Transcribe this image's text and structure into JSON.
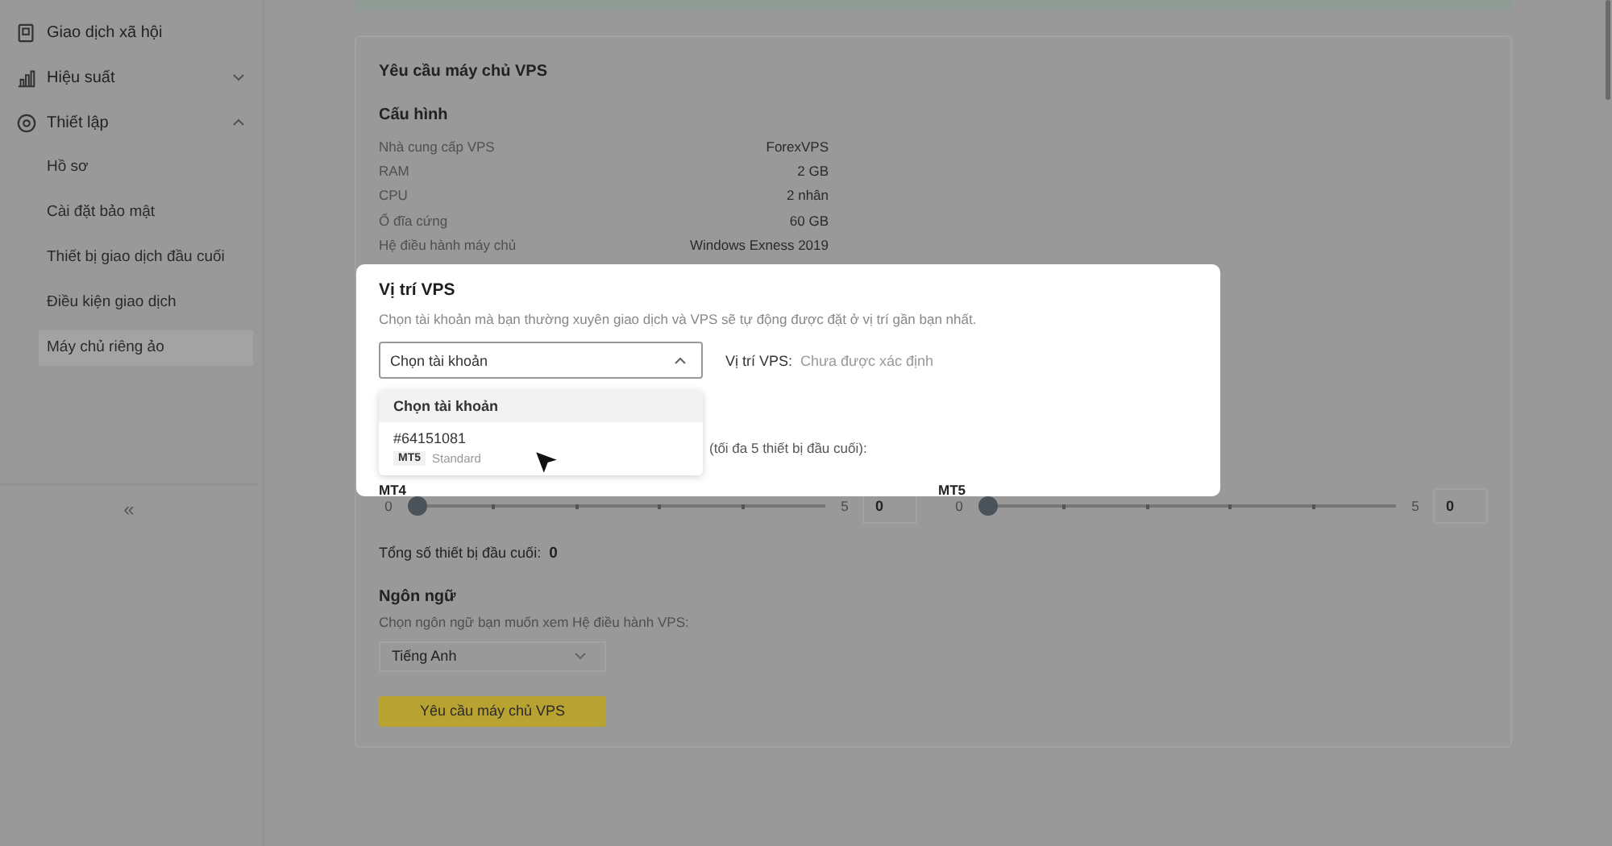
{
  "sidebar": {
    "items": [
      {
        "label": "Giao dịch xã hội"
      },
      {
        "label": "Hiệu suất",
        "expanded": false
      },
      {
        "label": "Thiết lập",
        "expanded": true,
        "children": [
          {
            "label": "Hồ sơ",
            "selected": false
          },
          {
            "label": "Cài đặt bảo mật",
            "selected": false
          },
          {
            "label": "Thiết bị giao dịch đầu cuối",
            "selected": false
          },
          {
            "label": "Điều kiện giao dịch",
            "selected": false
          },
          {
            "label": "Máy chủ riêng ảo",
            "selected": true
          }
        ]
      }
    ],
    "collapse": "«"
  },
  "card": {
    "title": "Yêu cầu máy chủ VPS",
    "config_title": "Cấu hình",
    "specs": [
      {
        "label": "Nhà cung cấp VPS",
        "value": "ForexVPS"
      },
      {
        "label": "RAM",
        "value": "2 GB"
      },
      {
        "label": "CPU",
        "value": "2 nhân"
      },
      {
        "label": "Ổ đĩa cứng",
        "value": "60 GB"
      },
      {
        "label": "Hệ điều hành máy chủ",
        "value": "Windows Exness 2019"
      }
    ],
    "terminals": [
      {
        "label": "MT4",
        "min": "0",
        "max": "5",
        "level": 0,
        "value": "0"
      },
      {
        "label": "MT5",
        "min": "0",
        "max": "5",
        "level": 0,
        "value": "0"
      }
    ],
    "terminals_hint": "(tối đa 5 thiết bị đầu cuối):",
    "total_label": "Tổng số thiết bị đầu cuối:",
    "total_value": "0",
    "language_title": "Ngôn ngữ",
    "language_desc": "Chọn ngôn ngữ bạn muốn xem Hệ điều hành VPS:",
    "language_value": "Tiếng Anh",
    "submit": "Yêu cầu máy chủ VPS"
  },
  "popover": {
    "title": "Vị trí VPS",
    "desc": "Chọn tài khoản mà bạn thường xuyên giao dịch và VPS sẽ tự động được đặt ở vị trí gần bạn nhất.",
    "select_value": "Chọn tài khoản",
    "location_label": "Vị trí VPS:",
    "location_value": "Chưa được xác định",
    "menu": [
      {
        "kind": "header",
        "label": "Chọn tài khoản"
      },
      {
        "kind": "account",
        "label": "#64151081",
        "tag": "MT5",
        "type": "Standard"
      }
    ]
  }
}
